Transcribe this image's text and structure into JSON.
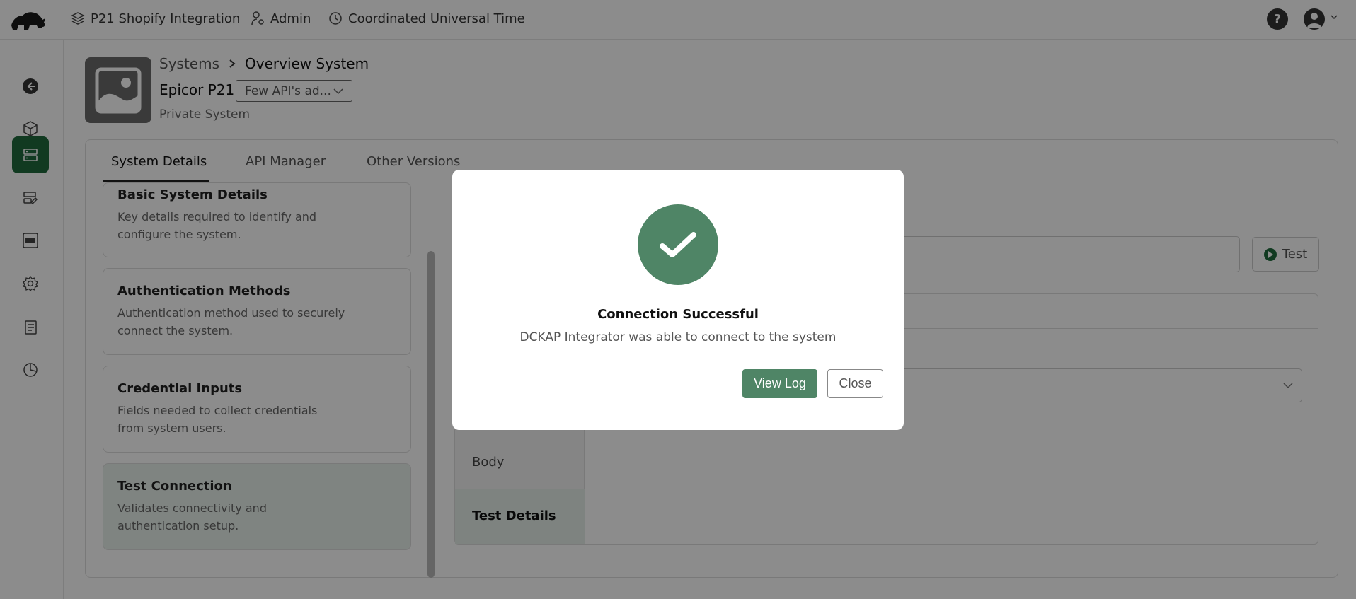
{
  "topbar": {
    "project": "P21 Shopify Integration",
    "role": "Admin",
    "timezone": "Coordinated Universal Time",
    "help_label": "?"
  },
  "breadcrumb": {
    "parent": "Systems",
    "current": "Overview System"
  },
  "system": {
    "name": "Epicor P21",
    "version_selected": "Few API's ad...",
    "type": "Private System"
  },
  "tabs": [
    {
      "label": "System Details",
      "active": true
    },
    {
      "label": "API Manager",
      "active": false
    },
    {
      "label": "Other Versions",
      "active": false
    }
  ],
  "cards": [
    {
      "title": "Basic System Details",
      "desc": [
        "Key details required to identify and",
        "configure the system."
      ]
    },
    {
      "title": "Authentication Methods",
      "desc": [
        "Authentication method used to securely",
        "connect the system."
      ]
    },
    {
      "title": "Credential Inputs",
      "desc": [
        "Fields needed to collect credentials",
        "from system users."
      ]
    },
    {
      "title": "Test Connection",
      "desc": [
        "Validates connectivity and",
        "authentication setup."
      ]
    }
  ],
  "test_button": "Test",
  "request_sections": {
    "body": "Body",
    "test_details": "Test Details"
  },
  "modal": {
    "title": "Connection Successful",
    "desc": "DCKAP Integrator was able to connect to the system",
    "primary": "View Log",
    "secondary": "Close"
  },
  "colors": {
    "accent": "#1f6b3d",
    "modal_accent": "#4f8566"
  }
}
